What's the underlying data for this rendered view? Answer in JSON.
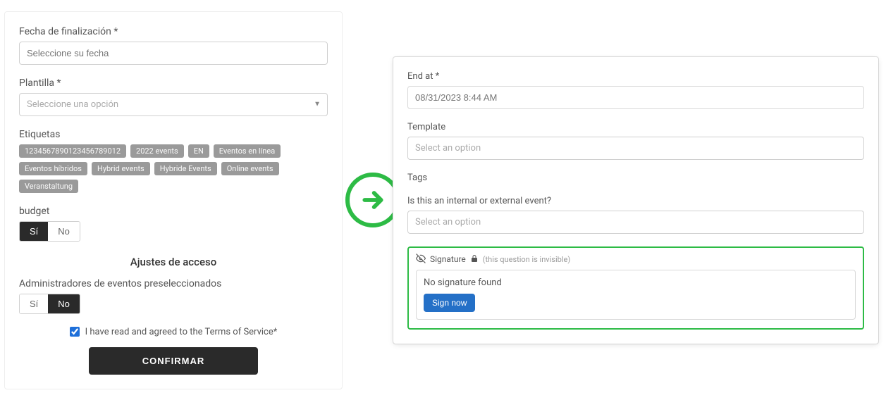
{
  "left": {
    "end_date_label": "Fecha de finalización *",
    "end_date_placeholder": "Seleccione su fecha",
    "template_label": "Plantilla *",
    "template_placeholder": "Seleccione una opción",
    "tags_label": "Etiquetas",
    "tags": [
      "1234567890123456789012",
      "2022 events",
      "EN",
      "Eventos en línea",
      "Eventos híbridos",
      "Hybrid events",
      "Hybride Events",
      "Online events",
      "Veranstaltung"
    ],
    "budget_label": "budget",
    "budget_yes": "Sí",
    "budget_no": "No",
    "budget_active": "yes",
    "access_heading": "Ajustes de acceso",
    "preselected_admins_label": "Administradores de eventos preseleccionados",
    "admins_yes": "Sí",
    "admins_no": "No",
    "admins_active": "no",
    "terms_text": "I have read and agreed to the Terms of Service*",
    "terms_checked": true,
    "confirm_label": "CONFIRMAR"
  },
  "right": {
    "end_at_label": "End at *",
    "end_at_value": "08/31/2023 8:44 AM",
    "template_label": "Template",
    "template_placeholder": "Select an option",
    "tags_label": "Tags",
    "internal_external_label": "Is this an internal or external event?",
    "internal_external_placeholder": "Select an option",
    "signature_label": "Signature",
    "signature_invisible_note": "(this question is invisible)",
    "signature_status": "No signature found",
    "sign_now_label": "Sign now"
  }
}
